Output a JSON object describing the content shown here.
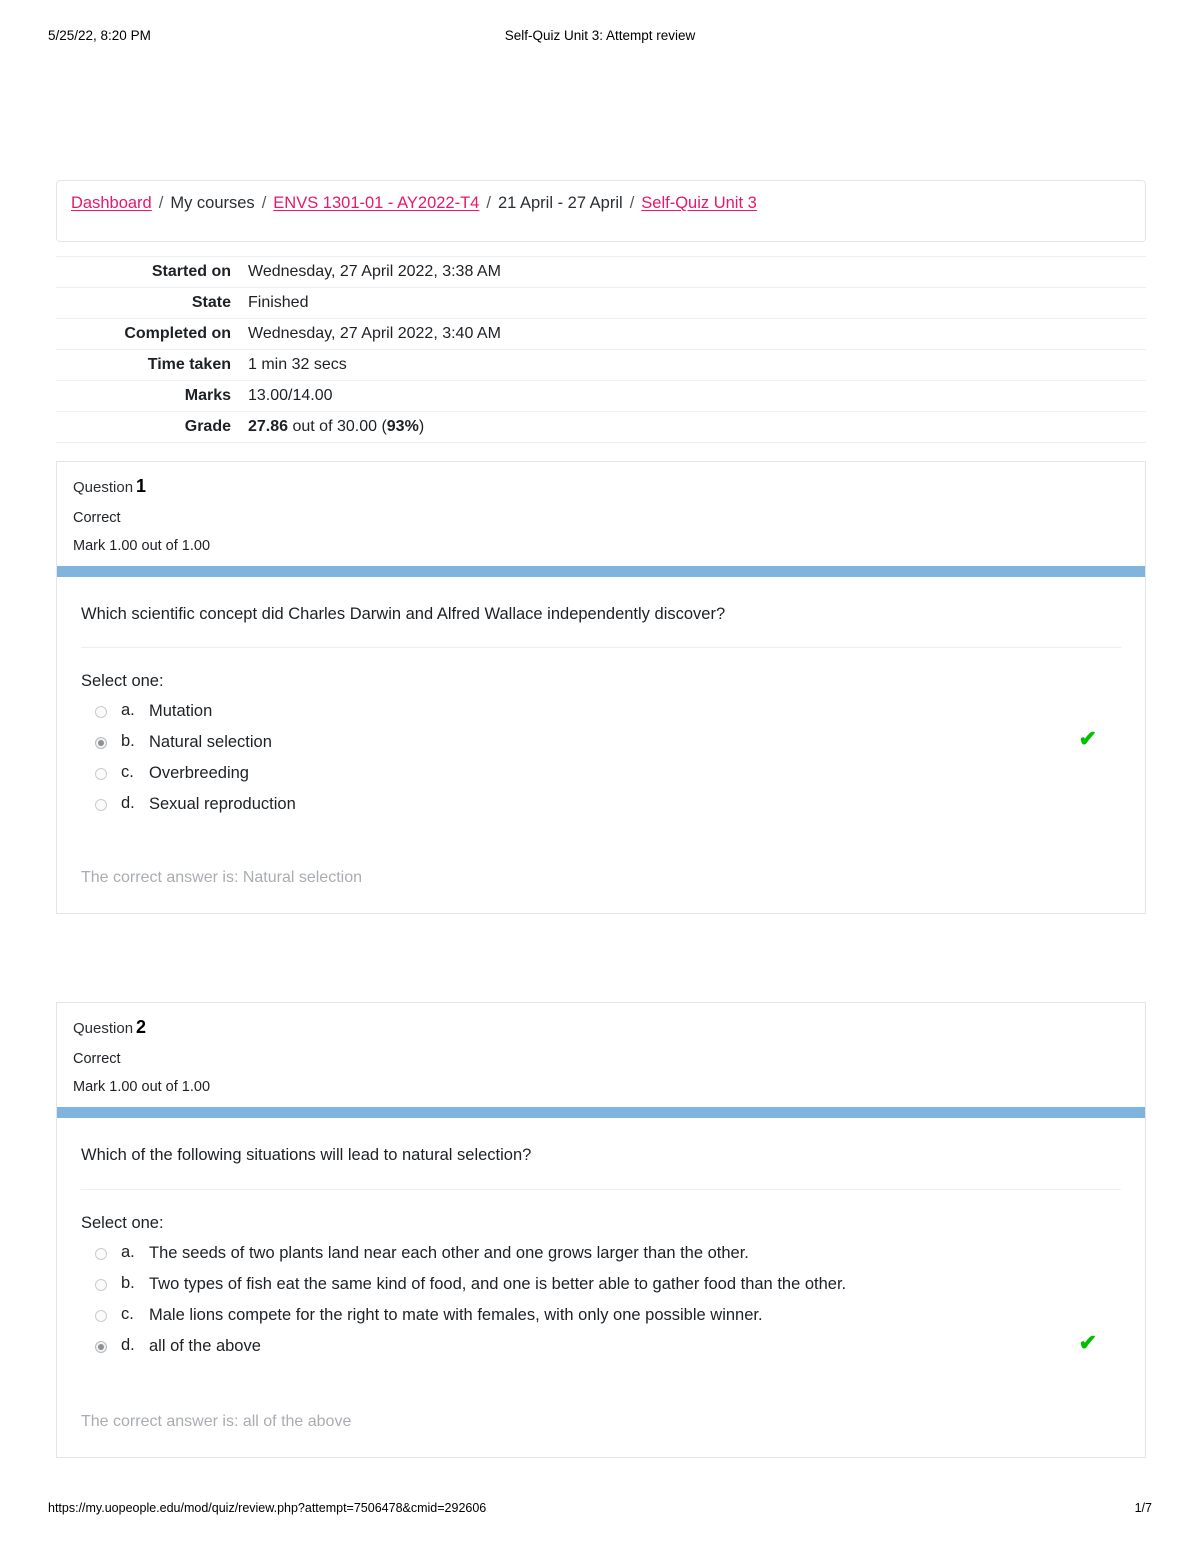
{
  "print": {
    "header_left": "5/25/22, 8:20 PM",
    "header_center": "Self-Quiz Unit 3: Attempt review",
    "footer_url": "https://my.uopeople.edu/mod/quiz/review.php?attempt=7506478&cmid=292606",
    "footer_page": "1/7"
  },
  "colors": {
    "link": "#e6176c",
    "question_bar": "#7eb4dd",
    "correct_tick": "#00c000",
    "muted_text": "#a9adb1"
  },
  "breadcrumb": {
    "items": [
      {
        "label": "Dashboard",
        "is_link": true
      },
      {
        "label": "My courses",
        "is_link": false
      },
      {
        "label": "ENVS 1301-01 - AY2022-T4",
        "is_link": true
      },
      {
        "label": "21 April - 27 April",
        "is_link": false
      },
      {
        "label": "Self-Quiz Unit 3",
        "is_link": true
      }
    ],
    "separator": "/"
  },
  "summary": {
    "rows": [
      {
        "label": "Started on",
        "value": "Wednesday, 27 April 2022, 3:38 AM"
      },
      {
        "label": "State",
        "value": "Finished"
      },
      {
        "label": "Completed on",
        "value": "Wednesday, 27 April 2022, 3:40 AM"
      },
      {
        "label": "Time taken",
        "value": "1 min 32 secs"
      },
      {
        "label": "Marks",
        "value": "13.00/14.00"
      }
    ],
    "grade": {
      "label": "Grade",
      "score": "27.86",
      "middle": " out of 30.00 (",
      "percent": "93%",
      "close": ")"
    }
  },
  "questions": [
    {
      "number_label": "Question",
      "number": "1",
      "state": "Correct",
      "mark": "Mark 1.00 out of 1.00",
      "text": "Which scientific concept did Charles Darwin and Alfred Wallace independently discover?",
      "select_label": "Select one:",
      "options": [
        {
          "letter": "a.",
          "text": "Mutation",
          "selected": false,
          "correct_tick": false
        },
        {
          "letter": "b.",
          "text": "Natural selection",
          "selected": true,
          "correct_tick": true
        },
        {
          "letter": "c.",
          "text": "Overbreeding",
          "selected": false,
          "correct_tick": false
        },
        {
          "letter": "d.",
          "text": "Sexual reproduction",
          "selected": false,
          "correct_tick": false
        }
      ],
      "feedback": "The correct answer is: Natural selection"
    },
    {
      "number_label": "Question",
      "number": "2",
      "state": "Correct",
      "mark": "Mark 1.00 out of 1.00",
      "text": "Which of the following situations will lead to natural selection?",
      "select_label": "Select one:",
      "options": [
        {
          "letter": "a.",
          "text": "The seeds of two plants land near each other and one grows larger than the other.",
          "selected": false,
          "correct_tick": false
        },
        {
          "letter": "b.",
          "text": "Two types of fish eat the same kind of food, and one is better able to gather food than the other.",
          "selected": false,
          "correct_tick": false
        },
        {
          "letter": "c.",
          "text": "Male lions compete for the right to mate with females, with only one possible winner.",
          "selected": false,
          "correct_tick": false
        },
        {
          "letter": "d.",
          "text": "all of the above",
          "selected": true,
          "correct_tick": true
        }
      ],
      "feedback": "The correct answer is: all of the above"
    }
  ]
}
